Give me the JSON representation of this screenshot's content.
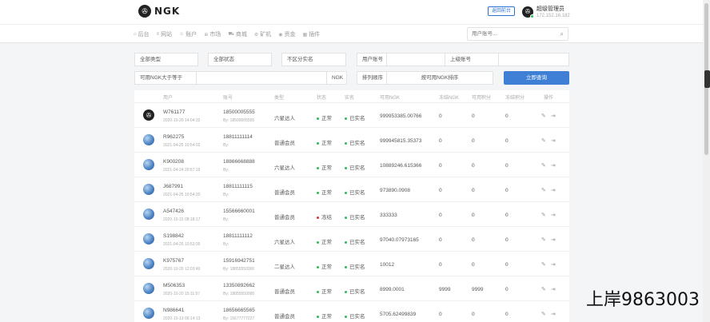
{
  "header": {
    "logo_text": "NGK",
    "back_button": "返回前台",
    "user_name": "超级管理员",
    "user_ip": "172.152.16.182"
  },
  "nav": {
    "items": [
      {
        "icon": "home-icon",
        "glyph": "⌂",
        "label": "后台"
      },
      {
        "icon": "list-icon",
        "glyph": "≡",
        "label": "网站"
      },
      {
        "icon": "users-icon",
        "glyph": "☺",
        "label": "账户"
      },
      {
        "icon": "globe-icon",
        "glyph": "⊕",
        "label": "市场"
      },
      {
        "icon": "cart-icon",
        "glyph": "⛟",
        "label": "商城"
      },
      {
        "icon": "gear-icon",
        "glyph": "⚙",
        "label": "矿机"
      },
      {
        "icon": "coin-icon",
        "glyph": "◉",
        "label": "资金"
      },
      {
        "icon": "plugin-icon",
        "glyph": "▦",
        "label": "插件"
      }
    ],
    "search_placeholder": "用户账号..."
  },
  "filters": {
    "type": "全部类型",
    "status": "全部状态",
    "realname": "不区分实名",
    "user_account_label": "用户账号",
    "parent_account_label": "上级账号",
    "ngk_gte_label": "可用NGK大于等于",
    "ngk_unit": "NGK",
    "sort_label": "排列顺序",
    "sort_value": "按可用NGK排序",
    "query_button": "立即查询"
  },
  "table": {
    "columns": [
      "用户",
      "账号",
      "类型",
      "状态",
      "实名",
      "可用NGK",
      "冻结NGK",
      "可用积分",
      "冻结积分",
      "操作"
    ],
    "rows": [
      {
        "avatar": "dark",
        "user": "W761177",
        "time": "2020-10-20 14:04:32",
        "account": "18500005555",
        "by": "By: 18500005555",
        "type": "六星达人",
        "status": "正常",
        "status_color": "#2dbd58",
        "real": "已实名",
        "ngk": "999953385.00766",
        "frozen_ngk": "0",
        "points": "0",
        "frozen_points": "0"
      },
      {
        "avatar": "globe",
        "user": "R962275",
        "time": "2021-04-25 10:54:02",
        "account": "18811111114",
        "by": "By:",
        "type": "普通会员",
        "status": "正常",
        "status_color": "#2dbd58",
        "real": "已实名",
        "ngk": "999945815.35373",
        "frozen_ngk": "0",
        "points": "0",
        "frozen_points": "0"
      },
      {
        "avatar": "globe",
        "user": "K900208",
        "time": "2021-04-24 20:57:19",
        "account": "18866668888",
        "by": "By:",
        "type": "六星达人",
        "status": "正常",
        "status_color": "#2dbd58",
        "real": "已实名",
        "ngk": "10889246.615366",
        "frozen_ngk": "0",
        "points": "0",
        "frozen_points": "0"
      },
      {
        "avatar": "globe",
        "user": "J687991",
        "time": "2021-04-25 10:54:20",
        "account": "18811111115",
        "by": "By:",
        "type": "普通会员",
        "status": "正常",
        "status_color": "#2dbd58",
        "real": "已实名",
        "ngk": "973890.0908",
        "frozen_ngk": "0",
        "points": "0",
        "frozen_points": "0"
      },
      {
        "avatar": "globe",
        "user": "A547426",
        "time": "2020-10-15 08:18:17",
        "account": "15566660001",
        "by": "By:",
        "type": "普通会员",
        "status": "冻结",
        "status_color": "#d9363e",
        "real": "已实名",
        "ngk": "333333",
        "frozen_ngk": "0",
        "points": "0",
        "frozen_points": "0"
      },
      {
        "avatar": "globe",
        "user": "S198842",
        "time": "2021-04-25 10:53:35",
        "account": "18811111112",
        "by": "By:",
        "type": "六星达人",
        "status": "正常",
        "status_color": "#2dbd58",
        "real": "已实名",
        "ngk": "97040.07973165",
        "frozen_ngk": "0",
        "points": "0",
        "frozen_points": "0"
      },
      {
        "avatar": "globe",
        "user": "K975767",
        "time": "2020-10-20 12:03:49",
        "account": "15916942751",
        "by": "By: 18855550000",
        "type": "二星达人",
        "status": "正常",
        "status_color": "#2dbd58",
        "real": "已实名",
        "ngk": "10012",
        "frozen_ngk": "0",
        "points": "0",
        "frozen_points": "0"
      },
      {
        "avatar": "globe",
        "user": "M506353",
        "time": "2020-10-20 15:11:57",
        "account": "13350892662",
        "by": "By: 18855550000",
        "type": "普通会员",
        "status": "正常",
        "status_color": "#2dbd58",
        "real": "已实名",
        "ngk": "8999.0001",
        "frozen_ngk": "9999",
        "points": "9999",
        "frozen_points": "0"
      },
      {
        "avatar": "globe",
        "user": "N986641",
        "time": "2020-10-13 06:14:13",
        "account": "18656665565",
        "by": "By: 15677777227",
        "type": "普通会员",
        "status": "正常",
        "status_color": "#2dbd58",
        "real": "已实名",
        "ngk": "5705.62499839",
        "frozen_ngk": "0",
        "points": "0",
        "frozen_points": "0"
      }
    ]
  },
  "watermark": "上岸9863003"
}
